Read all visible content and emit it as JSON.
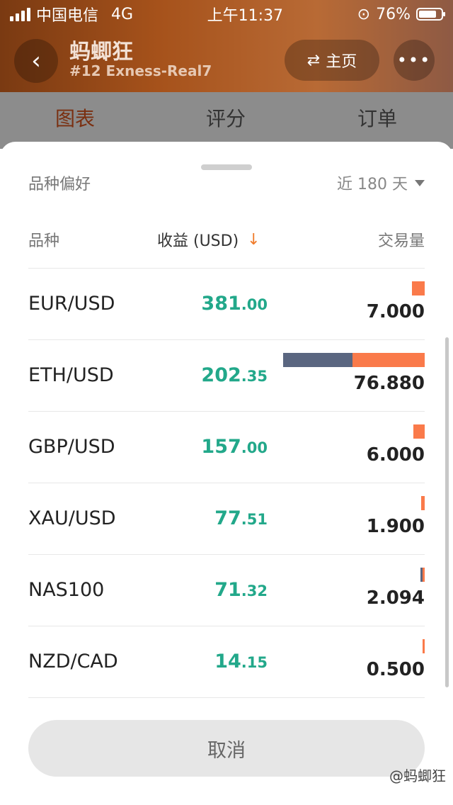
{
  "status_bar": {
    "carrier": "中国电信",
    "network": "4G",
    "time": "上午11:37",
    "battery": "76%"
  },
  "header": {
    "title": "蚂蝍狂",
    "subtitle": "#12 Exness-Real7",
    "home_label": "主页",
    "more_label": "•••"
  },
  "tabs": [
    {
      "label": "图表"
    },
    {
      "label": "评分"
    },
    {
      "label": "订单"
    }
  ],
  "sheet": {
    "title": "品种偏好",
    "period": "近 180 天",
    "columns": {
      "symbol": "品种",
      "profit": "收益 (USD)",
      "volume": "交易量"
    },
    "rows": [
      {
        "symbol": "EUR/USD",
        "profit_int": "381",
        "profit_dec": ".00",
        "volume": "7.000",
        "buy_share": 0.0,
        "sell_share": 0.091
      },
      {
        "symbol": "ETH/USD",
        "profit_int": "202",
        "profit_dec": ".35",
        "volume": "76.880",
        "buy_share": 0.49,
        "sell_share": 0.51
      },
      {
        "symbol": "GBP/USD",
        "profit_int": "157",
        "profit_dec": ".00",
        "volume": "6.000",
        "buy_share": 0.0,
        "sell_share": 0.078
      },
      {
        "symbol": "XAU/USD",
        "profit_int": "77",
        "profit_dec": ".51",
        "volume": "1.900",
        "buy_share": 0.0,
        "sell_share": 0.025
      },
      {
        "symbol": "NAS100",
        "profit_int": "71",
        "profit_dec": ".32",
        "volume": "2.094",
        "buy_share": 0.013,
        "sell_share": 0.013
      },
      {
        "symbol": "NZD/CAD",
        "profit_int": "14",
        "profit_dec": ".15",
        "volume": "0.500",
        "buy_share": 0.0,
        "sell_share": 0.007
      }
    ],
    "cancel_label": "取消"
  },
  "watermark": "@蚂蝍狂",
  "colors": {
    "profit": "#22a88a",
    "buy_bar": "#5a6680",
    "sell_bar": "#fa7a4a",
    "sort_arrow": "#f07b2a"
  }
}
